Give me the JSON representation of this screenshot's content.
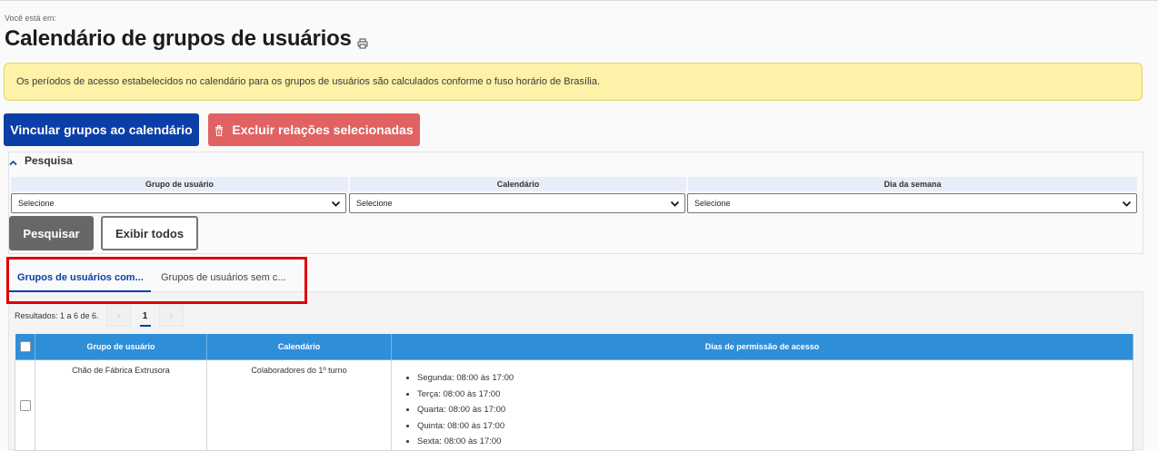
{
  "header": {
    "breadcrumb": "Você está em:",
    "title": "Calendário de grupos de usuários",
    "print_icon": "printer-icon"
  },
  "alert": {
    "text": "Os períodos de acesso estabelecidos no calendário para os grupos de usuários são calculados conforme o fuso horário de Brasília."
  },
  "actions": {
    "link_label": "Vincular grupos ao calendário",
    "delete_label": "Excluir relações selecionadas",
    "delete_icon": "trash-icon"
  },
  "search": {
    "toggle_label": "Pesquisa",
    "filters": [
      {
        "label": "Grupo de usuário",
        "value": "Selecione"
      },
      {
        "label": "Calendário",
        "value": "Selecione"
      },
      {
        "label": "Dia da semana",
        "value": "Selecione"
      }
    ],
    "search_label": "Pesquisar",
    "show_all_label": "Exibir todos"
  },
  "tabs": [
    {
      "label": "Grupos de usuários com...",
      "active": true
    },
    {
      "label": "Grupos de usuários sem c...",
      "active": false
    }
  ],
  "results": {
    "summary": "Resultados: 1 a 6 de 6.",
    "pagination": {
      "prev": "‹",
      "current": "1",
      "next": "›"
    },
    "columns": [
      "Grupo de usuário",
      "Calendário",
      "Dias de permissão de acesso"
    ],
    "rows": [
      {
        "group": "Chão de Fábrica Extrusora",
        "calendar": "Colaboradores do 1º turno",
        "days": [
          "Segunda: 08:00 às 17:00",
          "Terça: 08:00 às 17:00",
          "Quarta: 08:00 às 17:00",
          "Quinta: 08:00 às 17:00",
          "Sexta: 08:00 às 17:00"
        ]
      }
    ]
  },
  "colors": {
    "primary": "#0b3fa8",
    "danger": "#e06262",
    "alert_bg": "#fdf2a7",
    "table_header": "#2e8ed8",
    "highlight": "#e00000"
  }
}
